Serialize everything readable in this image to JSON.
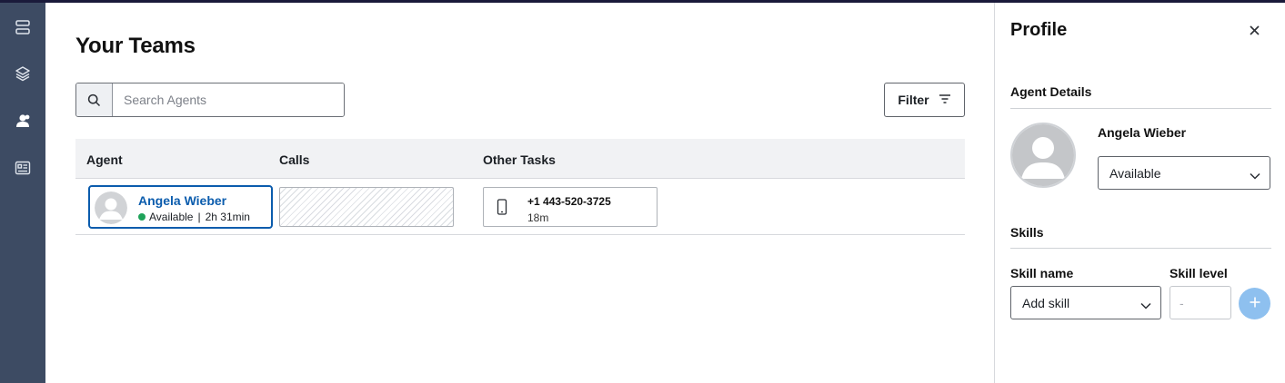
{
  "rail": {
    "items": [
      {
        "icon": "queue-icon"
      },
      {
        "icon": "layers-icon"
      },
      {
        "icon": "team-icon"
      },
      {
        "icon": "contact-card-icon"
      }
    ]
  },
  "main": {
    "title": "Your Teams",
    "search": {
      "placeholder": "Search Agents",
      "value": ""
    },
    "filter_label": "Filter",
    "columns": [
      "Agent",
      "Calls",
      "Other Tasks"
    ],
    "rows": [
      {
        "agent_name": "Angela Wieber",
        "status": "Available",
        "duration": "2h 31min",
        "status_color": "#1fa35a",
        "task_number": "+1 443-520-3725",
        "task_time": "18m"
      }
    ]
  },
  "panel": {
    "title": "Profile",
    "agent_details_title": "Agent Details",
    "agent_name": "Angela Wieber",
    "status_selected": "Available",
    "skills_title": "Skills",
    "skill_name_label": "Skill name",
    "skill_level_label": "Skill level",
    "skill_select_value": "Add skill",
    "skill_level_placeholder": "-"
  },
  "colors": {
    "rail": "#3d4b63",
    "accent": "#0b5cad",
    "add_button": "#8ec0ef"
  }
}
